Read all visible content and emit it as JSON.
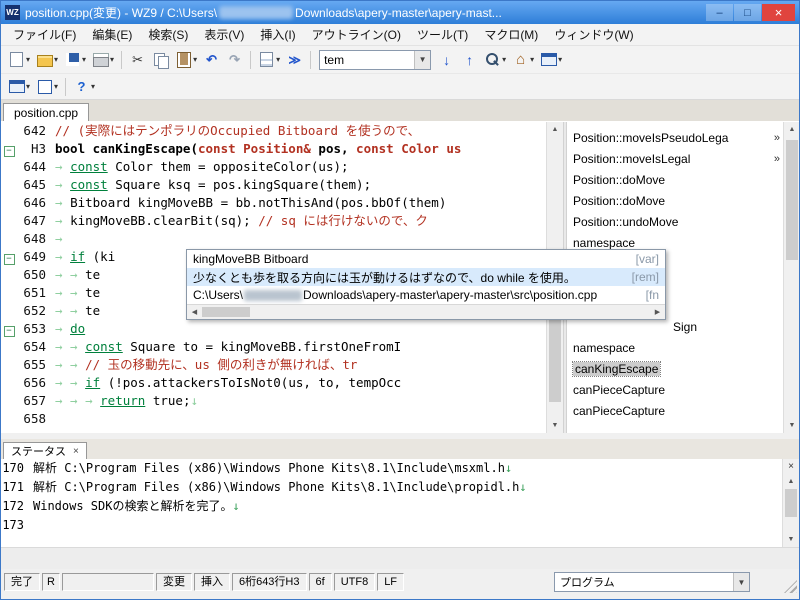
{
  "window": {
    "icon": "WZ",
    "title_prefix": "position.cpp(変更) - WZ9 / C:\\Users\\",
    "title_suffix": "Downloads\\apery-master\\apery-mast...",
    "controls": {
      "minimize": "–",
      "maximize": "□",
      "close": "×"
    }
  },
  "menubar": {
    "items": [
      "ファイル(F)",
      "編集(E)",
      "検索(S)",
      "表示(V)",
      "挿入(I)",
      "アウトライン(O)",
      "ツール(T)",
      "マクロ(M)",
      "ウィンドウ(W)"
    ]
  },
  "toolbar": {
    "combo_value": "tem",
    "row1": [
      {
        "name": "new-document",
        "icon": "page",
        "drop": true
      },
      {
        "name": "open-folder",
        "icon": "folder",
        "drop": true
      },
      {
        "name": "save",
        "icon": "floppy",
        "drop": true
      },
      {
        "name": "print",
        "icon": "printer",
        "drop": true
      },
      {
        "sep": true
      },
      {
        "name": "cut",
        "icon": "cut",
        "glyph": "✂"
      },
      {
        "name": "copy",
        "icon": "copy"
      },
      {
        "name": "paste",
        "icon": "paste",
        "drop": true
      },
      {
        "name": "undo",
        "icon": "undo",
        "glyph": "↶"
      },
      {
        "name": "redo",
        "icon": "redo",
        "glyph": "↷"
      },
      {
        "sep": true
      },
      {
        "name": "insert-document",
        "icon": "doc",
        "drop": true
      },
      {
        "name": "jump",
        "icon": "jump",
        "glyph": "≫"
      },
      {
        "sep": true
      },
      {
        "combo": true
      },
      {
        "name": "search-down",
        "icon": "down",
        "glyph": "↓"
      },
      {
        "name": "search-up",
        "icon": "up",
        "glyph": "↑"
      },
      {
        "name": "find",
        "icon": "find",
        "drop": true
      },
      {
        "name": "home",
        "icon": "home",
        "glyph": "⌂",
        "drop": true
      },
      {
        "name": "tool-window",
        "icon": "window",
        "drop": true
      }
    ],
    "row2": [
      {
        "name": "view-window",
        "icon": "window",
        "drop": true
      },
      {
        "name": "view-frame",
        "icon": "frame",
        "drop": true
      },
      {
        "sep": true
      },
      {
        "name": "help",
        "icon": "help",
        "glyph": "?",
        "drop": true
      }
    ]
  },
  "tabs": [
    {
      "label": "position.cpp"
    }
  ],
  "editor": {
    "lines": [
      {
        "n": "642",
        "s": [
          [
            "c",
            "// (実際にはテンポラリのOccupied Bitboard を使うので、"
          ]
        ]
      },
      {
        "n": "H3",
        "f": 1,
        "s": [
          [
            "b",
            "bool canKingEscape("
          ],
          [
            "r",
            "const Position&"
          ],
          [
            "b",
            " pos, "
          ],
          [
            "r",
            "const Color us"
          ]
        ]
      },
      {
        "n": "644",
        "s": [
          [
            "t",
            "→ "
          ],
          [
            "k",
            "const"
          ],
          [
            "n",
            " Color them = oppositeColor(us);"
          ]
        ]
      },
      {
        "n": "645",
        "s": [
          [
            "t",
            "→ "
          ],
          [
            "k",
            "const"
          ],
          [
            "n",
            " Square ksq = pos.kingSquare(them);"
          ]
        ]
      },
      {
        "n": "646",
        "s": [
          [
            "t",
            "→ "
          ],
          [
            "n",
            "Bitboard kingMoveBB = bb.notThisAnd(pos.bbOf(them)"
          ]
        ]
      },
      {
        "n": "647",
        "s": [
          [
            "t",
            "→ "
          ],
          [
            "n",
            "kingMoveBB.clearBit(sq); "
          ],
          [
            "c",
            "// sq には行けないので、ク"
          ]
        ]
      },
      {
        "n": "648",
        "s": [
          [
            "t",
            "→ "
          ]
        ]
      },
      {
        "n": "649",
        "f": 1,
        "s": [
          [
            "t",
            "→ "
          ],
          [
            "k",
            "if"
          ],
          [
            "n",
            " (ki"
          ]
        ]
      },
      {
        "n": "650",
        "s": [
          [
            "t",
            "→ → "
          ],
          [
            "n",
            "te"
          ]
        ]
      },
      {
        "n": "651",
        "s": [
          [
            "t",
            "→ → "
          ],
          [
            "n",
            "te"
          ]
        ]
      },
      {
        "n": "652",
        "s": [
          [
            "t",
            "→ → "
          ],
          [
            "n",
            "te"
          ]
        ]
      },
      {
        "n": "653",
        "f": 1,
        "s": [
          [
            "t",
            "→ "
          ],
          [
            "k",
            "do"
          ]
        ]
      },
      {
        "n": "654",
        "s": [
          [
            "t",
            "→ → "
          ],
          [
            "k",
            "const"
          ],
          [
            "n",
            " Square to = kingMoveBB.firstOneFromI"
          ]
        ]
      },
      {
        "n": "655",
        "s": [
          [
            "t",
            "→ → "
          ],
          [
            "c",
            "// 玉の移動先に、us 側の利きが無ければ、tr"
          ]
        ]
      },
      {
        "n": "656",
        "s": [
          [
            "t",
            "→ → "
          ],
          [
            "k",
            "if"
          ],
          [
            "n",
            " (!pos.attackersToIsNot0(us, to, tempOcc"
          ]
        ]
      },
      {
        "n": "657",
        "s": [
          [
            "t",
            "→ → → "
          ],
          [
            "k",
            "return"
          ],
          [
            "n",
            " true;"
          ],
          [
            "e",
            "↓"
          ]
        ]
      },
      {
        "n": "658",
        "s": []
      }
    ]
  },
  "tooltip": {
    "symbol": "kingMoveBB Bitboard",
    "symbol_tag": "[var]",
    "remark": "少なくとも歩を取る方向には玉が動けるはずなので、do while を使用。",
    "remark_tag": "[rem]",
    "path_prefix": "C:\\Users\\",
    "path_suffix": "Downloads\\apery-master\\apery-master\\src\\position.cpp",
    "path_tag": "[fn"
  },
  "outline": {
    "items": [
      {
        "label": "Position::moveIsPseudoLega",
        "more": "»",
        "row": 0
      },
      {
        "label": "Position::moveIsLegal",
        "more": "»",
        "row": 1
      },
      {
        "label": "Position::doMove",
        "row": 2
      },
      {
        "label": "Position::doMove",
        "row": 3
      },
      {
        "label": "Position::undoMove",
        "row": 4
      },
      {
        "label": "namespace",
        "row": 5
      },
      {
        "label": "Sign",
        "row": 9,
        "indent": 100
      },
      {
        "label": "namespace",
        "row": 10
      },
      {
        "label": "canKingEscape",
        "row": 11,
        "selected": true
      },
      {
        "label": "canPieceCapture",
        "row": 12
      },
      {
        "label": "canPieceCapture",
        "row": 13
      }
    ]
  },
  "spanel": {
    "tab_label": "ステータス",
    "close": "×",
    "lines": [
      {
        "num": "170",
        "text": "解析 C:\\Program Files (x86)\\Windows Phone Kits\\8.1\\Include\\msxml.h",
        "eol": "↓"
      },
      {
        "num": "171",
        "text": "解析 C:\\Program Files (x86)\\Windows Phone Kits\\8.1\\Include\\propidl.h",
        "eol": "↓"
      },
      {
        "num": "172",
        "text": "Windows SDKの検索と解析を完了。",
        "eol": "↓"
      },
      {
        "num": "173",
        "text": "",
        "eol": ""
      }
    ]
  },
  "statusbar": {
    "ready": "完了",
    "r": "R",
    "modified": "変更",
    "insert": "挿入",
    "caret": "6桁643行H3",
    "charcode": "6f",
    "encoding": "UTF8",
    "linebreak": "LF",
    "mode": "プログラム"
  },
  "colors": {
    "titlebar_blue": "#2e7ed8",
    "close_red": "#e0443e",
    "keyword_green": "#00803c",
    "comment_red": "#b23121",
    "tabmark_green": "#8fcf9f",
    "remark_bg": "#d8eafc"
  }
}
